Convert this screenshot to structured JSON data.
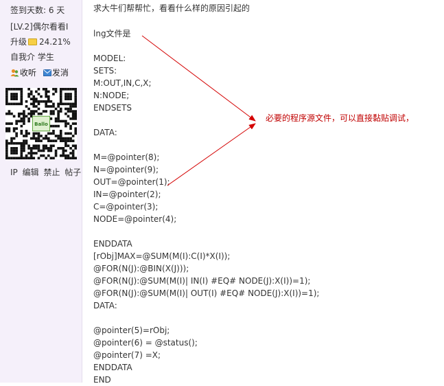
{
  "sidebar": {
    "checkin_days": "签到天数: 6 天",
    "level": "[LV.2]偶尔看看I",
    "upgrade_label": "升级",
    "upgrade_percent": "24.21%",
    "intro": "自我介  学生",
    "favorite_label": "收听",
    "message_label": "发消",
    "bottom_links": [
      "IP",
      "编辑",
      "禁止",
      "帖子"
    ],
    "qr_logo_text": "Ballo"
  },
  "post": {
    "title": "求大牛们帮帮忙，看看什么样的原因引起的",
    "code_lines": [
      "lng文件是",
      "",
      "MODEL:",
      "SETS:",
      "M:OUT,IN,C,X;",
      "N:NODE;",
      "ENDSETS",
      "",
      "DATA:",
      "",
      "M=@pointer(8);",
      "N=@pointer(9);",
      "OUT=@pointer(1);",
      "IN=@pointer(2);",
      "C=@pointer(3);",
      "NODE=@pointer(4);",
      "",
      "ENDDATA",
      "[rObj]MAX=@SUM(M(I):C(I)*X(I));",
      "@FOR(N(J):@BIN(X(J)));",
      "@FOR(N(J):@SUM(M(I)| IN(I) #EQ# NODE(J):X(I))=1);",
      "@FOR(N(J):@SUM(M(I)| OUT(I) #EQ# NODE(J):X(I))=1);",
      "DATA:",
      "",
      "@pointer(5)=rObj;",
      "@pointer(6) = @status();",
      "@pointer(7) =X;",
      "ENDDATA",
      "END"
    ],
    "annotation": "必要的程序源文件，可以直接黏贴调试，"
  },
  "colors": {
    "sidebar_bg": "#f5f0fa",
    "annotation": "#c00000",
    "arrow": "#d40000"
  }
}
